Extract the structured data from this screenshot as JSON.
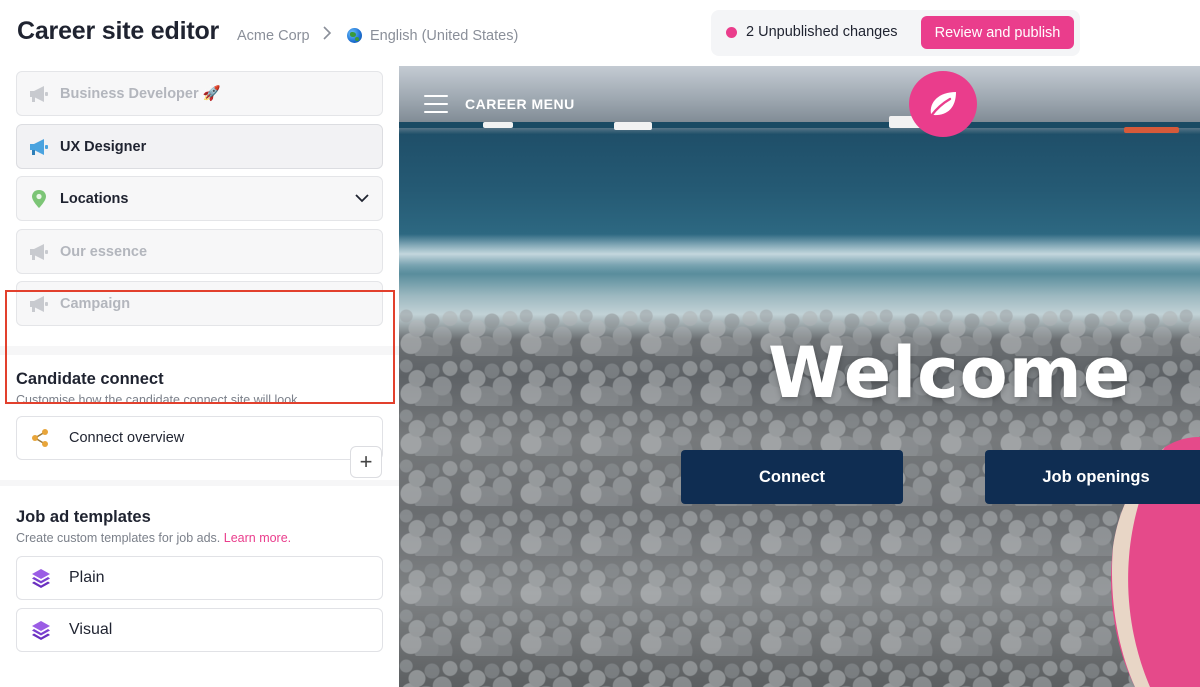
{
  "header": {
    "title": "Career site editor",
    "breadcrumb": [
      "Acme Corp",
      "English (United States)"
    ],
    "unpublished": "2 Unpublished changes",
    "publish_button": "Review and publish"
  },
  "sidebar": {
    "pages": [
      {
        "label": "Business Developer 🚀",
        "state": "disabled",
        "icon": "megaphone-icon"
      },
      {
        "label": "UX Designer",
        "state": "enabled",
        "icon": "megaphone-icon"
      },
      {
        "label": "Locations",
        "state": "enabled",
        "icon": "location-pin-icon",
        "expandable": true
      },
      {
        "label": "Our essence",
        "state": "disabled",
        "icon": "megaphone-icon"
      },
      {
        "label": "Campaign",
        "state": "disabled",
        "icon": "megaphone-icon"
      }
    ],
    "candidate_connect": {
      "title": "Candidate connect",
      "description": "Customise how the candidate connect site will look",
      "item": "Connect overview"
    },
    "job_ad_templates": {
      "title": "Job ad templates",
      "description": "Create custom templates for job ads.",
      "learn_more": "Learn more.",
      "add_label": "+",
      "items": [
        "Plain",
        "Visual"
      ]
    }
  },
  "preview": {
    "menu_label": "CAREER MENU",
    "headline": "Welcome",
    "buttons": [
      "Connect",
      "Job openings"
    ]
  },
  "colors": {
    "accent": "#ea3d8c",
    "navy": "#0f2d52",
    "highlight": "#e2402d"
  }
}
